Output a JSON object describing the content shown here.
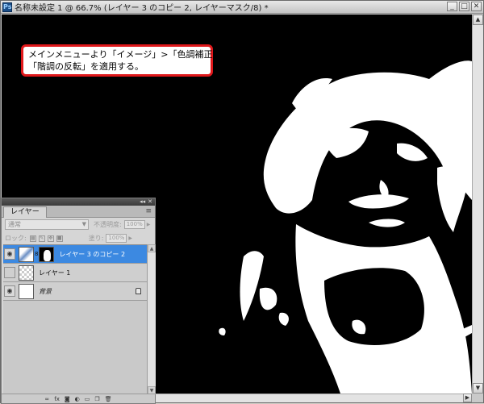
{
  "window": {
    "title": "名称未設定 1 @ 66.7% (レイヤー 3 のコピー 2, レイヤーマスク/8) *",
    "controls": {
      "minimize": "_",
      "maximize": "□",
      "close": "✕"
    }
  },
  "callout": {
    "line1": "メインメニューより「イメージ」>「色調補正」>",
    "line2": "「階調の反転」を適用する。"
  },
  "layers_panel": {
    "tab": "レイヤー",
    "blend_mode": "通常",
    "opacity_label": "不透明度:",
    "opacity_value": "100%",
    "lock_label": "ロック:",
    "fill_label": "塗り:",
    "fill_value": "100%",
    "layers": [
      {
        "name": "レイヤー 3 のコピー 2",
        "visible": true,
        "selected": true
      },
      {
        "name": "レイヤー 1",
        "visible": false,
        "selected": false
      },
      {
        "name": "背景",
        "visible": true,
        "selected": false,
        "locked": true
      }
    ]
  },
  "colors": {
    "selection": "#3c89e1",
    "callout_border": "#e0181b",
    "canvas": "#000000"
  }
}
